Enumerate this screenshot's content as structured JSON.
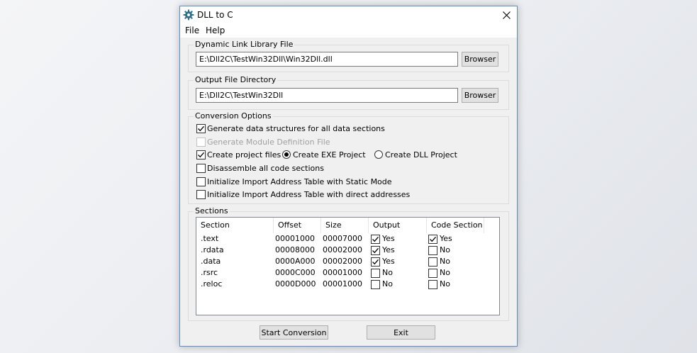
{
  "window": {
    "title": "DLL to C"
  },
  "menu": {
    "file": "File",
    "help": "Help"
  },
  "dll_group": {
    "label": "Dynamic Link Library File",
    "path": "E:\\Dll2C\\TestWin32Dll\\Win32Dll.dll",
    "browse": "Browser"
  },
  "output_group": {
    "label": "Output File Directory",
    "path": "E:\\Dll2C\\TestWin32Dll",
    "browse": "Browser"
  },
  "options": {
    "label": "Conversion Options",
    "gen_structs": {
      "label": "Generate data structures for all data sections",
      "checked": true
    },
    "gen_module_def": {
      "label": "Generate Module Definition File",
      "checked": false,
      "enabled": false
    },
    "create_project": {
      "label": "Create project files",
      "checked": true
    },
    "exe_project": {
      "label": "Create EXE Project",
      "selected": true
    },
    "dll_project": {
      "label": "Create DLL Project",
      "selected": false
    },
    "disassemble": {
      "label": "Disassemble all code sections",
      "checked": false
    },
    "iat_static": {
      "label": "Initialize Import Address Table with Static Mode",
      "checked": false
    },
    "iat_direct": {
      "label": "Initialize Import Address Table with direct addresses",
      "checked": false
    }
  },
  "sections": {
    "label": "Sections",
    "columns": [
      "Section",
      "Offset",
      "Size",
      "Output",
      "Code Section"
    ],
    "rows": [
      {
        "name": ".text",
        "offset": "00001000",
        "size": "00007000",
        "output": "Yes",
        "output_checked": true,
        "code": "Yes",
        "code_checked": true
      },
      {
        "name": ".rdata",
        "offset": "00008000",
        "size": "00002000",
        "output": "Yes",
        "output_checked": true,
        "code": "No",
        "code_checked": false
      },
      {
        "name": ".data",
        "offset": "0000A000",
        "size": "00002000",
        "output": "Yes",
        "output_checked": true,
        "code": "No",
        "code_checked": false
      },
      {
        "name": ".rsrc",
        "offset": "0000C000",
        "size": "00001000",
        "output": "No",
        "output_checked": false,
        "code": "No",
        "code_checked": false
      },
      {
        "name": ".reloc",
        "offset": "0000D000",
        "size": "00001000",
        "output": "No",
        "output_checked": false,
        "code": "No",
        "code_checked": false
      }
    ]
  },
  "buttons": {
    "start": "Start Conversion",
    "exit": "Exit"
  },
  "icons": {
    "app": "gear-icon",
    "close": "close-icon",
    "check": "checkmark-icon"
  },
  "colors": {
    "window_border": "#5b8fc7",
    "app_icon": "#2e6e8e"
  }
}
